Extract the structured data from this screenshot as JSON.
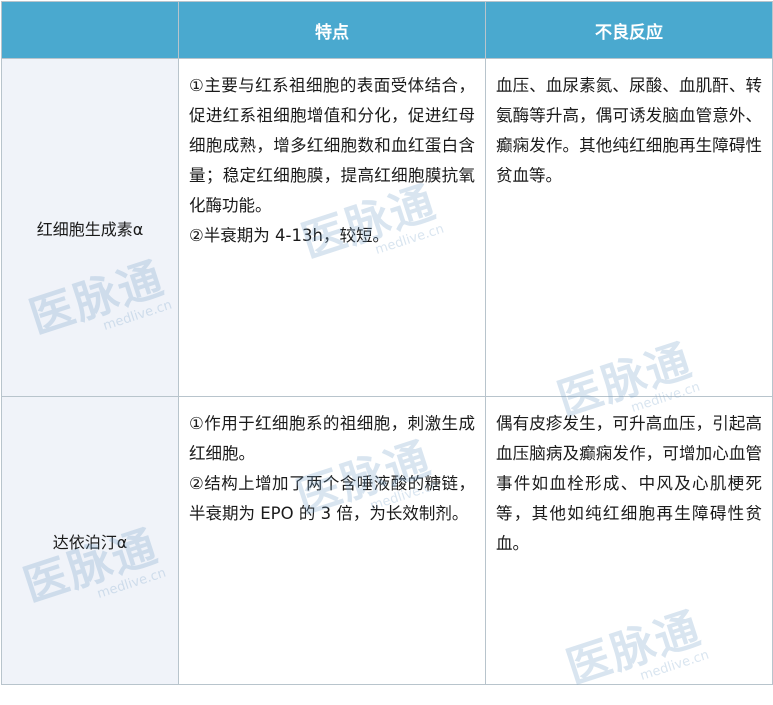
{
  "header": {
    "col0": "",
    "col1": "特点",
    "col2": "不良反应"
  },
  "rows": [
    {
      "name": "红细胞生成素α",
      "features": [
        "①主要与红系祖细胞的表面受体结合，促进红系祖细胞增值和分化，促进红母细胞成熟，增多红细胞数和血红蛋白含量；稳定红细胞膜，提高红细胞膜抗氧化酶功能。",
        "②半衰期为 4-13h，较短。"
      ],
      "adverse": "血压、血尿素氮、尿酸、血肌酐、转氨酶等升高，偶可诱发脑血管意外、癫痫发作。其他纯红细胞再生障碍性贫血等。"
    },
    {
      "name": "达依泊汀α",
      "features": [
        "①作用于红细胞系的祖细胞，刺激生成红细胞。",
        "②结构上增加了两个含唾液酸的糖链，半衰期为 EPO 的 3 倍，为长效制剂。"
      ],
      "adverse": "偶有皮疹发生，可升高血压，引起高血压脑病及癫痫发作，可增加心血管事件如血栓形成、中风及心肌梗死等，其他如纯红细胞再生障碍性贫血。"
    }
  ],
  "watermark": {
    "brand": "医脉通",
    "domain": "medlive.cn"
  }
}
